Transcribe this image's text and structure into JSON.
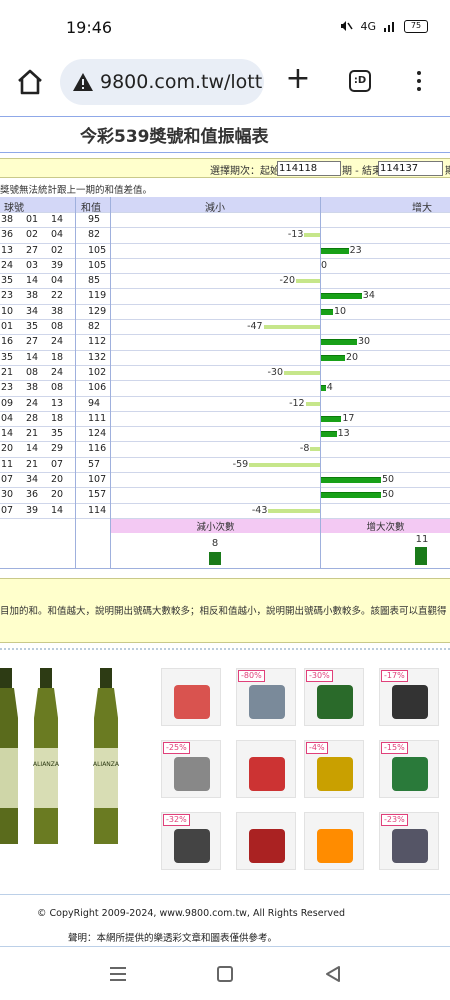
{
  "status": {
    "time": "19:46",
    "battery": "75",
    "signal_text": "4G"
  },
  "browser": {
    "url": "9800.com.tw/lott",
    "tabs_label": ":D"
  },
  "page": {
    "title": "今彩539獎號和值振幅表",
    "period_label": "選擇期次：起始",
    "period_start": "114118",
    "period_mid": "期 - 結束",
    "period_end": "114137",
    "period_tail": "期",
    "note": "獎號無法統計跟上一期的和值差值。"
  },
  "table": {
    "headers": {
      "balls": "球號",
      "sum": "和值",
      "decrease": "減小",
      "increase": "增大"
    },
    "rows": [
      {
        "b1": "38",
        "b2": "01",
        "b3": "14",
        "sum": "95",
        "diff": ""
      },
      {
        "b1": "36",
        "b2": "02",
        "b3": "04",
        "sum": "82",
        "diff": "-13"
      },
      {
        "b1": "13",
        "b2": "27",
        "b3": "02",
        "sum": "105",
        "diff": "23"
      },
      {
        "b1": "24",
        "b2": "03",
        "b3": "39",
        "sum": "105",
        "diff": "0"
      },
      {
        "b1": "35",
        "b2": "14",
        "b3": "04",
        "sum": "85",
        "diff": "-20"
      },
      {
        "b1": "23",
        "b2": "38",
        "b3": "22",
        "sum": "119",
        "diff": "34"
      },
      {
        "b1": "10",
        "b2": "34",
        "b3": "38",
        "sum": "129",
        "diff": "10"
      },
      {
        "b1": "01",
        "b2": "35",
        "b3": "08",
        "sum": "82",
        "diff": "-47"
      },
      {
        "b1": "16",
        "b2": "27",
        "b3": "24",
        "sum": "112",
        "diff": "30"
      },
      {
        "b1": "35",
        "b2": "14",
        "b3": "18",
        "sum": "132",
        "diff": "20"
      },
      {
        "b1": "21",
        "b2": "08",
        "b3": "24",
        "sum": "102",
        "diff": "-30"
      },
      {
        "b1": "23",
        "b2": "38",
        "b3": "08",
        "sum": "106",
        "diff": "4"
      },
      {
        "b1": "09",
        "b2": "24",
        "b3": "13",
        "sum": "94",
        "diff": "-12"
      },
      {
        "b1": "04",
        "b2": "28",
        "b3": "18",
        "sum": "111",
        "diff": "17"
      },
      {
        "b1": "14",
        "b2": "21",
        "b3": "35",
        "sum": "124",
        "diff": "13"
      },
      {
        "b1": "20",
        "b2": "14",
        "b3": "29",
        "sum": "116",
        "diff": "-8"
      },
      {
        "b1": "11",
        "b2": "21",
        "b3": "07",
        "sum": "57",
        "diff": "-59"
      },
      {
        "b1": "07",
        "b2": "34",
        "b3": "20",
        "sum": "107",
        "diff": "50"
      },
      {
        "b1": "30",
        "b2": "36",
        "b3": "20",
        "sum": "157",
        "diff": "50"
      },
      {
        "b1": "07",
        "b2": "39",
        "b3": "14",
        "sum": "114",
        "diff": "-43"
      }
    ],
    "count_headers": {
      "decrease": "減小次數",
      "increase": "增大次數"
    },
    "decrease_count": "8",
    "increase_count": "11"
  },
  "explain": "目加的和。和值越大，說明開出號碼大數較多；相反和值越小，說明開出號碼小數較多。該圖表可以直觀得",
  "ads": {
    "bottle_brand": "ALIANZA",
    "discounts": [
      "-80%",
      "-30%",
      "-17%",
      "-25%",
      "-4%",
      "-15%",
      "-32%",
      "-23%"
    ]
  },
  "footer": {
    "copyright": "© CopyRight 2009-2024, www.9800.com.tw, All Rights Reserved",
    "disclaimer": "聲明：本網所提供的樂透彩文章和圖表僅供參考。"
  },
  "colors": {
    "increase_bar": "#18a018",
    "decrease_bar": "#c6e68a",
    "header_bg": "#d3d7f7",
    "yellow_bg": "#ffffcc"
  }
}
